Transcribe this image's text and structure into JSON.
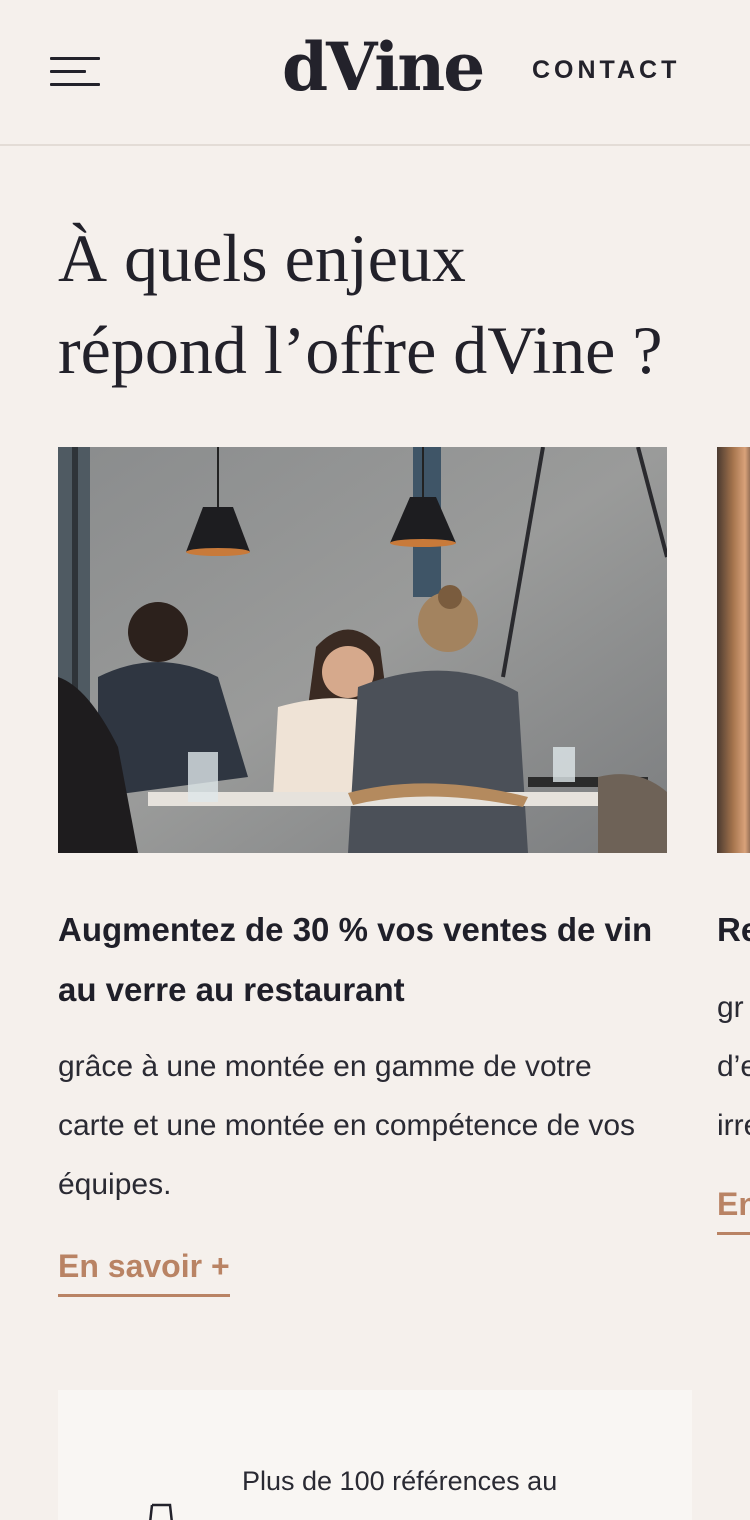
{
  "header": {
    "logo": "dVine",
    "contact_label": "CONTACT",
    "menu_icon": "hamburger-menu-icon"
  },
  "main": {
    "heading_line1": "À quels enjeux",
    "heading_line2": "répond l’offre dVine ?",
    "cards": [
      {
        "title": "Augmentez de 30 % vos ventes de vin au verre au restaurant",
        "text": "grâce à une montée en gamme de votre carte et une montée en compétence de vos équipes.",
        "link": "En savoir +"
      },
      {
        "title": "Re",
        "text_lines": [
          "gr",
          "d’e",
          "irre"
        ],
        "link": "En"
      }
    ],
    "feature": {
      "text": "Plus de 100 références au",
      "icon": "wine-glass-icon"
    }
  },
  "colors": {
    "background": "#f5f0ec",
    "text": "#1f1f29",
    "accent": "#b98364"
  }
}
